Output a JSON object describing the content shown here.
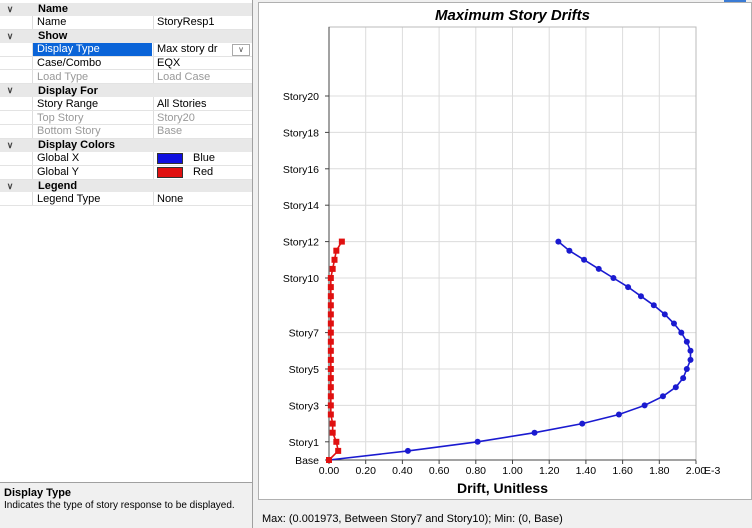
{
  "properties": {
    "categories": [
      {
        "label": "Name",
        "rows": [
          {
            "name": "Name",
            "value": "StoryResp1"
          }
        ]
      },
      {
        "label": "Show",
        "rows": [
          {
            "name": "Display Type",
            "value": "Max story dr",
            "selected": true,
            "dropdown": true
          },
          {
            "name": "Case/Combo",
            "value": "EQX"
          },
          {
            "name": "Load Type",
            "value": "Load Case",
            "disabled": true
          }
        ]
      },
      {
        "label": "Display For",
        "rows": [
          {
            "name": "Story Range",
            "value": "All Stories"
          },
          {
            "name": "Top Story",
            "value": "Story20",
            "disabled": true
          },
          {
            "name": "Bottom Story",
            "value": "Base",
            "disabled": true
          }
        ]
      },
      {
        "label": "Display Colors",
        "rows": [
          {
            "name": "Global X",
            "value": "Blue",
            "swatch": "#1010e0"
          },
          {
            "name": "Global Y",
            "value": "Red",
            "swatch": "#e01010"
          }
        ]
      },
      {
        "label": "Legend",
        "rows": [
          {
            "name": "Legend Type",
            "value": "None"
          }
        ]
      }
    ]
  },
  "description": {
    "title": "Display Type",
    "text": "Indicates the type of story response to be displayed."
  },
  "status_text": "Max: (0.001973, Between Story7 and Story10);   Min: (0, Base)",
  "colors": {
    "series_x": "#1a1ad0",
    "series_y": "#e01010"
  },
  "chart_data": {
    "type": "line",
    "title": "Maximum Story Drifts",
    "xlabel": "Drift, Unitless",
    "x_unit": "E-3",
    "xlim": [
      0,
      2.0
    ],
    "x_ticks": [
      "0.00",
      "0.20",
      "0.40",
      "0.60",
      "0.80",
      "1.00",
      "1.20",
      "1.40",
      "1.60",
      "1.80",
      "2.00"
    ],
    "y_labels": [
      {
        "label": "Base",
        "level": 0
      },
      {
        "label": "Story1",
        "level": 1
      },
      {
        "label": "Story3",
        "level": 3
      },
      {
        "label": "Story5",
        "level": 5
      },
      {
        "label": "Story7",
        "level": 7
      },
      {
        "label": "Story10",
        "level": 10
      },
      {
        "label": "Story12",
        "level": 12
      },
      {
        "label": "Story14",
        "level": 14
      },
      {
        "label": "Story16",
        "level": 16
      },
      {
        "label": "Story18",
        "level": 18
      },
      {
        "label": "Story20",
        "level": 20
      }
    ],
    "series": [
      {
        "color_key": "series_x",
        "marker": "circle",
        "points": [
          [
            0,
            0
          ],
          [
            0.43,
            0.5
          ],
          [
            0.81,
            1
          ],
          [
            1.12,
            1.5
          ],
          [
            1.38,
            2
          ],
          [
            1.58,
            2.5
          ],
          [
            1.72,
            3
          ],
          [
            1.82,
            3.5
          ],
          [
            1.89,
            4
          ],
          [
            1.93,
            4.5
          ],
          [
            1.95,
            5
          ],
          [
            1.97,
            5.5
          ],
          [
            1.97,
            6
          ],
          [
            1.95,
            6.5
          ],
          [
            1.92,
            7
          ],
          [
            1.88,
            7.5
          ],
          [
            1.83,
            8
          ],
          [
            1.77,
            8.5
          ],
          [
            1.7,
            9
          ],
          [
            1.63,
            9.5
          ],
          [
            1.55,
            10
          ],
          [
            1.47,
            10.5
          ],
          [
            1.39,
            11
          ],
          [
            1.31,
            11.5
          ],
          [
            1.25,
            12
          ]
        ]
      },
      {
        "color_key": "series_y",
        "marker": "square",
        "points": [
          [
            0,
            0
          ],
          [
            0.05,
            0.5
          ],
          [
            0.04,
            1
          ],
          [
            0.02,
            1.5
          ],
          [
            0.02,
            2
          ],
          [
            0.01,
            2.5
          ],
          [
            0.01,
            3
          ],
          [
            0.01,
            3.5
          ],
          [
            0.01,
            4
          ],
          [
            0.01,
            4.5
          ],
          [
            0.01,
            5
          ],
          [
            0.01,
            5.5
          ],
          [
            0.01,
            6
          ],
          [
            0.01,
            6.5
          ],
          [
            0.01,
            7
          ],
          [
            0.01,
            7.5
          ],
          [
            0.01,
            8
          ],
          [
            0.01,
            8.5
          ],
          [
            0.01,
            9
          ],
          [
            0.01,
            9.5
          ],
          [
            0.01,
            10
          ],
          [
            0.02,
            10.5
          ],
          [
            0.03,
            11
          ],
          [
            0.04,
            11.5
          ],
          [
            0.07,
            12
          ]
        ]
      }
    ]
  }
}
